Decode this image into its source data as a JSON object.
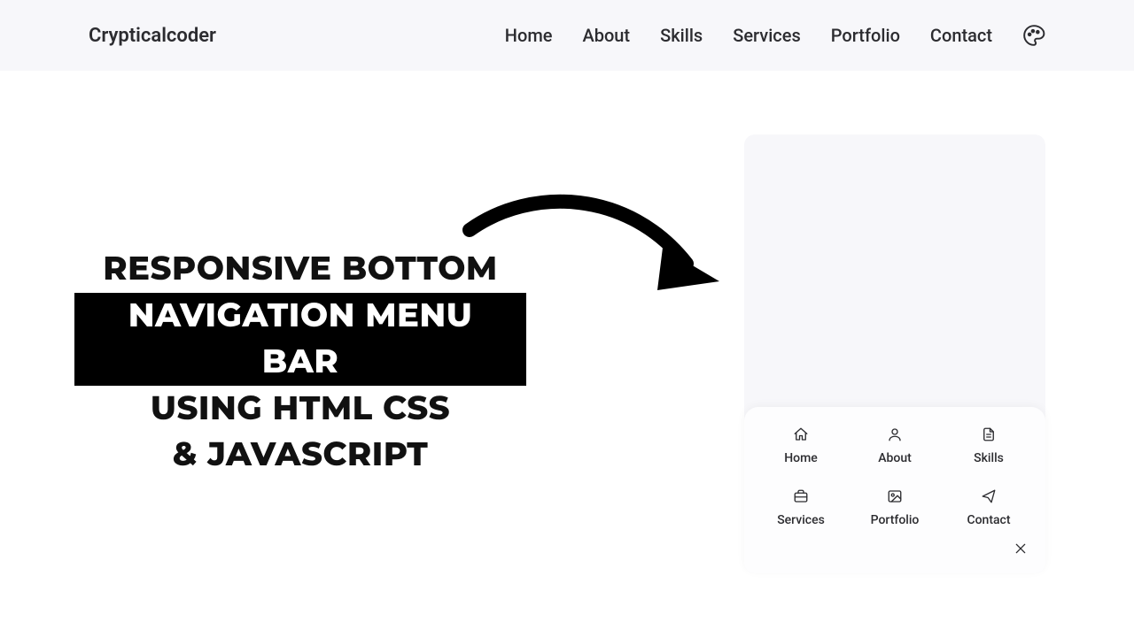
{
  "header": {
    "logo": "Crypticalcoder",
    "nav": [
      {
        "label": "Home"
      },
      {
        "label": "About"
      },
      {
        "label": "Skills"
      },
      {
        "label": "Services"
      },
      {
        "label": "Portfolio"
      },
      {
        "label": "Contact"
      }
    ],
    "theme_icon": "palette-icon"
  },
  "title": {
    "line1": "RESPONSIVE BOTTOM",
    "line2": "NAVIGATION MENU BAR",
    "line3": "USING HTML CSS",
    "line4": "& JAVASCRIPT"
  },
  "bottom_nav": {
    "items": [
      {
        "label": "Home",
        "icon": "home-icon"
      },
      {
        "label": "About",
        "icon": "user-icon"
      },
      {
        "label": "Skills",
        "icon": "file-icon"
      },
      {
        "label": "Services",
        "icon": "briefcase-icon"
      },
      {
        "label": "Portfolio",
        "icon": "image-icon"
      },
      {
        "label": "Contact",
        "icon": "send-icon"
      }
    ],
    "close_icon": "close-icon"
  }
}
